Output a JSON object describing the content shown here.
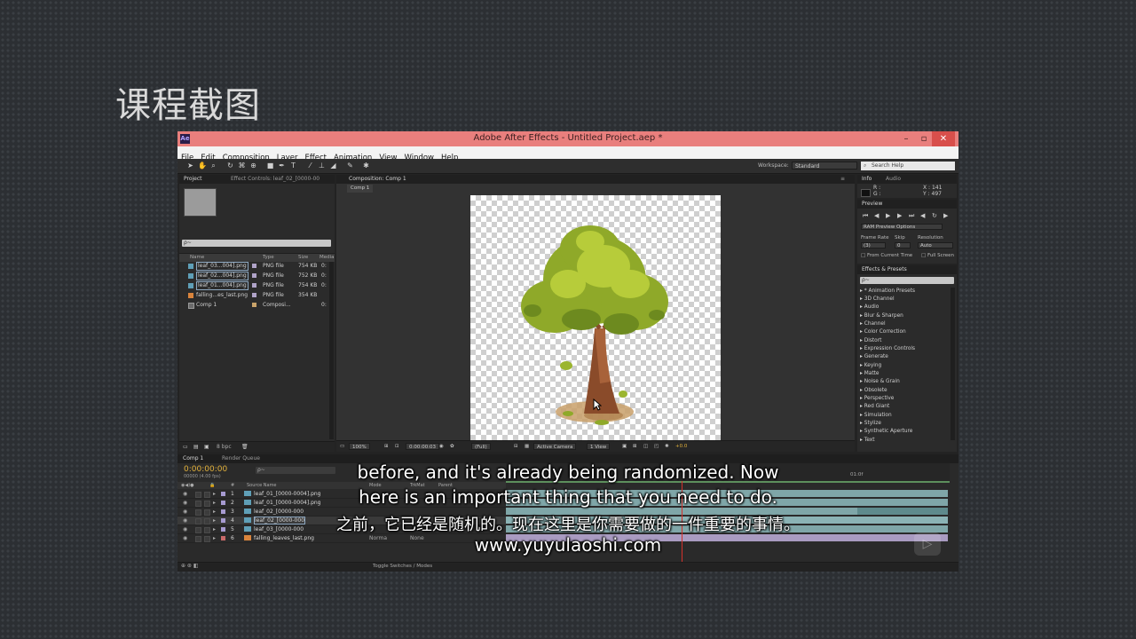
{
  "slide": {
    "title": "课程截图"
  },
  "window": {
    "title": "Adobe After Effects - Untitled Project.aep *",
    "app_icon_text": "Ae"
  },
  "menu": [
    "File",
    "Edit",
    "Composition",
    "Layer",
    "Effect",
    "Animation",
    "View",
    "Window",
    "Help"
  ],
  "toolbar": {
    "workspace_label": "Workspace:",
    "workspace_value": "Standard",
    "search_help": "Search Help"
  },
  "project_panel": {
    "tab_project": "Project",
    "tab_effect_controls": "Effect Controls: leaf_02_[0000-00",
    "search_placeholder": "ρ~",
    "columns": {
      "name": "Name",
      "type": "Type",
      "size": "Size",
      "media": "Media"
    },
    "items": [
      {
        "name": "leaf_03...004].png",
        "type": "PNG file",
        "size": "754 KB",
        "dur": "0:"
      },
      {
        "name": "leaf_02...004].png",
        "type": "PNG file",
        "size": "752 KB",
        "dur": "0:"
      },
      {
        "name": "leaf_01...004].png",
        "type": "PNG file",
        "size": "754 KB",
        "dur": "0:"
      },
      {
        "name": "falling...es_last.png",
        "type": "PNG file",
        "size": "354 KB",
        "dur": ""
      },
      {
        "name": "Comp 1",
        "type": "Composi...",
        "size": "",
        "dur": "0:"
      }
    ],
    "bpc": "8 bpc"
  },
  "composition_panel": {
    "tab": "Composition: Comp 1",
    "subtab": "Comp 1",
    "zoom": "100%",
    "time": "0:00:00:03",
    "resolution": "(Full)",
    "camera": "Active Camera",
    "view": "1 View",
    "exposure": "+0.0"
  },
  "info_panel": {
    "tab_info": "Info",
    "tab_audio": "Audio",
    "r": "R :",
    "g": "G :",
    "x": "X : 141",
    "y": "Y : 497"
  },
  "preview_panel": {
    "tab": "Preview",
    "ram_preview": "RAM Preview Options",
    "frame_rate_label": "Frame Rate",
    "skip_label": "Skip",
    "resolution_label": "Resolution",
    "frame_rate_value": "(3)",
    "skip_value": "0",
    "resolution_value": "Auto",
    "from_current": "From Current Time",
    "full_screen": "Full Screen"
  },
  "effects_panel": {
    "tab": "Effects & Presets",
    "search_placeholder": "ρ~",
    "items": [
      "* Animation Presets",
      "3D Channel",
      "Audio",
      "Blur & Sharpen",
      "Channel",
      "Color Correction",
      "Distort",
      "Expression Controls",
      "Generate",
      "Keying",
      "Matte",
      "Noise & Grain",
      "Obsolete",
      "Perspective",
      "Red Giant",
      "Simulation",
      "Stylize",
      "Synthetic Aperture",
      "Text"
    ]
  },
  "timeline": {
    "tab_comp": "Comp 1",
    "tab_render": "Render Queue",
    "timecode": "0:00:00:00",
    "fps": "00000 (4.00 fps)",
    "headers": {
      "source_name": "Source Name",
      "mode": "Mode",
      "trkmat": "TrkMat",
      "parent": "Parent"
    },
    "ruler_label": "01:0f",
    "layers": [
      {
        "num": "1",
        "name": "leaf_01_[0000-0004].png",
        "mode": "",
        "trk": ""
      },
      {
        "num": "2",
        "name": "leaf_01_[0000-0004].png",
        "mode": "",
        "trk": ""
      },
      {
        "num": "3",
        "name": "leaf_02_[0000-000",
        "mode": "",
        "trk": ""
      },
      {
        "num": "4",
        "name": "leaf_02_[0000-000",
        "mode": "",
        "trk": ""
      },
      {
        "num": "5",
        "name": "leaf_03_[0000-000",
        "mode": "",
        "trk": ""
      },
      {
        "num": "6",
        "name": "falling_leaves_last.png",
        "mode": "Norma",
        "trk": "None"
      }
    ],
    "toggle_label": "Toggle Switches / Modes"
  },
  "subtitles": {
    "en_line1": "before, and it's already being randomized. Now",
    "en_line2": "here is an important thing that you need to do.",
    "zh": "之前，它已经是随机的。现在这里是你需要做的一件重要的事情。",
    "site": "www.yuyulaoshi.com"
  }
}
